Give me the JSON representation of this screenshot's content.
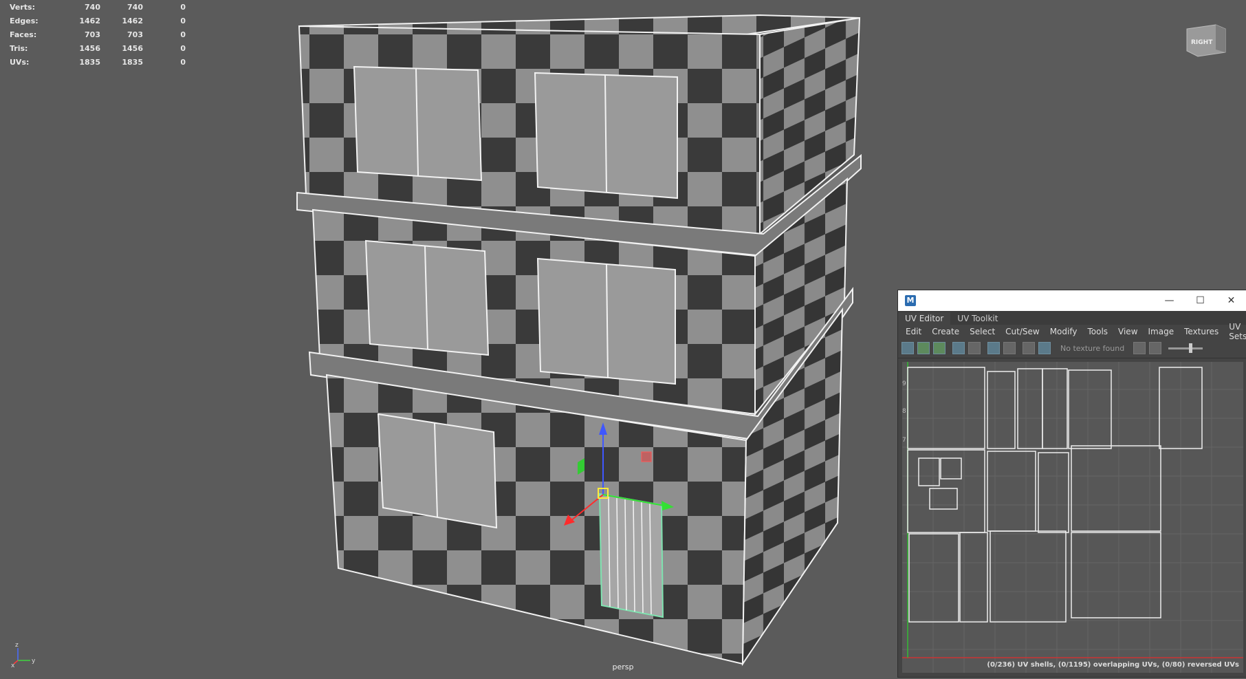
{
  "stats": {
    "rows": [
      {
        "label": "Verts:",
        "v1": "740",
        "v2": "740",
        "v3": "0"
      },
      {
        "label": "Edges:",
        "v1": "1462",
        "v2": "1462",
        "v3": "0"
      },
      {
        "label": "Faces:",
        "v1": "703",
        "v2": "703",
        "v3": "0"
      },
      {
        "label": "Tris:",
        "v1": "1456",
        "v2": "1456",
        "v3": "0"
      },
      {
        "label": "UVs:",
        "v1": "1835",
        "v2": "1835",
        "v3": "0"
      }
    ]
  },
  "viewport": {
    "camera_label": "persp",
    "viewcube_label": "RIGHT",
    "axis": {
      "z": "z",
      "y": "y",
      "x": "x"
    }
  },
  "uv_editor": {
    "app_icon": "M",
    "window_controls": {
      "minimize": "—",
      "maximize": "☐",
      "close": "✕"
    },
    "tabs": [
      "UV Editor",
      "UV Toolkit"
    ],
    "menu": [
      "Edit",
      "Create",
      "Select",
      "Cut/Sew",
      "Modify",
      "Tools",
      "View",
      "Image",
      "Textures",
      "UV Sets"
    ],
    "texture_status": "No texture found",
    "status_line": "(0/236) UV shells, (0/1195) overlapping UVs, (0/80) reversed UVs",
    "grid_labels": [
      "9",
      "8",
      "7"
    ]
  },
  "colors": {
    "background": "#5b5b5b",
    "checker_dark": "#3a3a3a",
    "checker_light": "#8f8f8f",
    "wire": "#f2f2f2",
    "selection": "#7fe3b0"
  }
}
